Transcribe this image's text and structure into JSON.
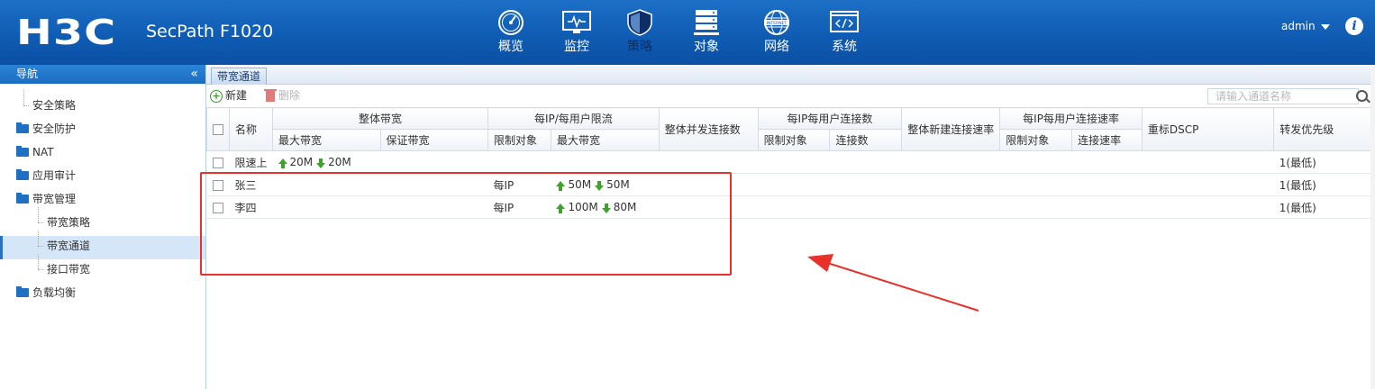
{
  "header": {
    "brand": "H3C",
    "product": "SecPath F1020",
    "nav": [
      {
        "label": "概览",
        "icon": "dashboard-gauge-icon"
      },
      {
        "label": "监控",
        "icon": "monitor-icon"
      },
      {
        "label": "策略",
        "icon": "shield-icon",
        "active": true
      },
      {
        "label": "对象",
        "icon": "server-stack-icon"
      },
      {
        "label": "网络",
        "icon": "internet-globe-icon"
      },
      {
        "label": "系统",
        "icon": "code-window-icon"
      }
    ],
    "user": "admin",
    "info_glyph": "i"
  },
  "sidebar": {
    "title": "导航",
    "collapse_glyph": "«",
    "items": [
      {
        "label": "安全策略"
      },
      {
        "label": "安全防护"
      },
      {
        "label": "NAT"
      },
      {
        "label": "应用审计"
      },
      {
        "label": "带宽管理"
      },
      {
        "label": "带宽策略"
      },
      {
        "label": "带宽通道"
      },
      {
        "label": "接口带宽"
      },
      {
        "label": "负载均衡"
      }
    ]
  },
  "tab": {
    "label": "带宽通道"
  },
  "toolbar": {
    "new_label": "新建",
    "delete_label": "删除",
    "search_placeholder": "请输入通道名称"
  },
  "table": {
    "headers": {
      "name": "名称",
      "overall_bw": "整体带宽",
      "max_bw": "最大带宽",
      "guaranteed_bw": "保证带宽",
      "per_ip_limit": "每IP/每用户限流",
      "limit_target": "限制对象",
      "per_ip_max_bw": "最大带宽",
      "overall_conn": "整体并发连接数",
      "per_ip_conn": "每IP每用户连接数",
      "per_ip_conn_target": "限制对象",
      "per_ip_conn_count": "连接数",
      "overall_new_rate": "整体新建连接速率",
      "per_ip_rate": "每IP每用户连接速率",
      "per_ip_rate_target": "限制对象",
      "per_ip_rate_value": "连接速率",
      "dscp": "重标DSCP",
      "priority": "转发优先级"
    },
    "rows": [
      {
        "name": "限速上",
        "overall_up": "20M",
        "overall_down": "20M",
        "limit_target": "",
        "per_up": "",
        "per_down": "",
        "priority": "1(最低)"
      },
      {
        "name": "张三",
        "overall_up": "",
        "overall_down": "",
        "limit_target": "每IP",
        "per_up": "50M",
        "per_down": "50M",
        "priority": "1(最低)"
      },
      {
        "name": "李四",
        "overall_up": "",
        "overall_down": "",
        "limit_target": "每IP",
        "per_up": "100M",
        "per_down": "80M",
        "priority": "1(最低)"
      }
    ]
  },
  "colors": {
    "header_blue": "#0f5cb4",
    "annotation_red": "#e8312a",
    "arrow_green": "#3ea22c"
  }
}
